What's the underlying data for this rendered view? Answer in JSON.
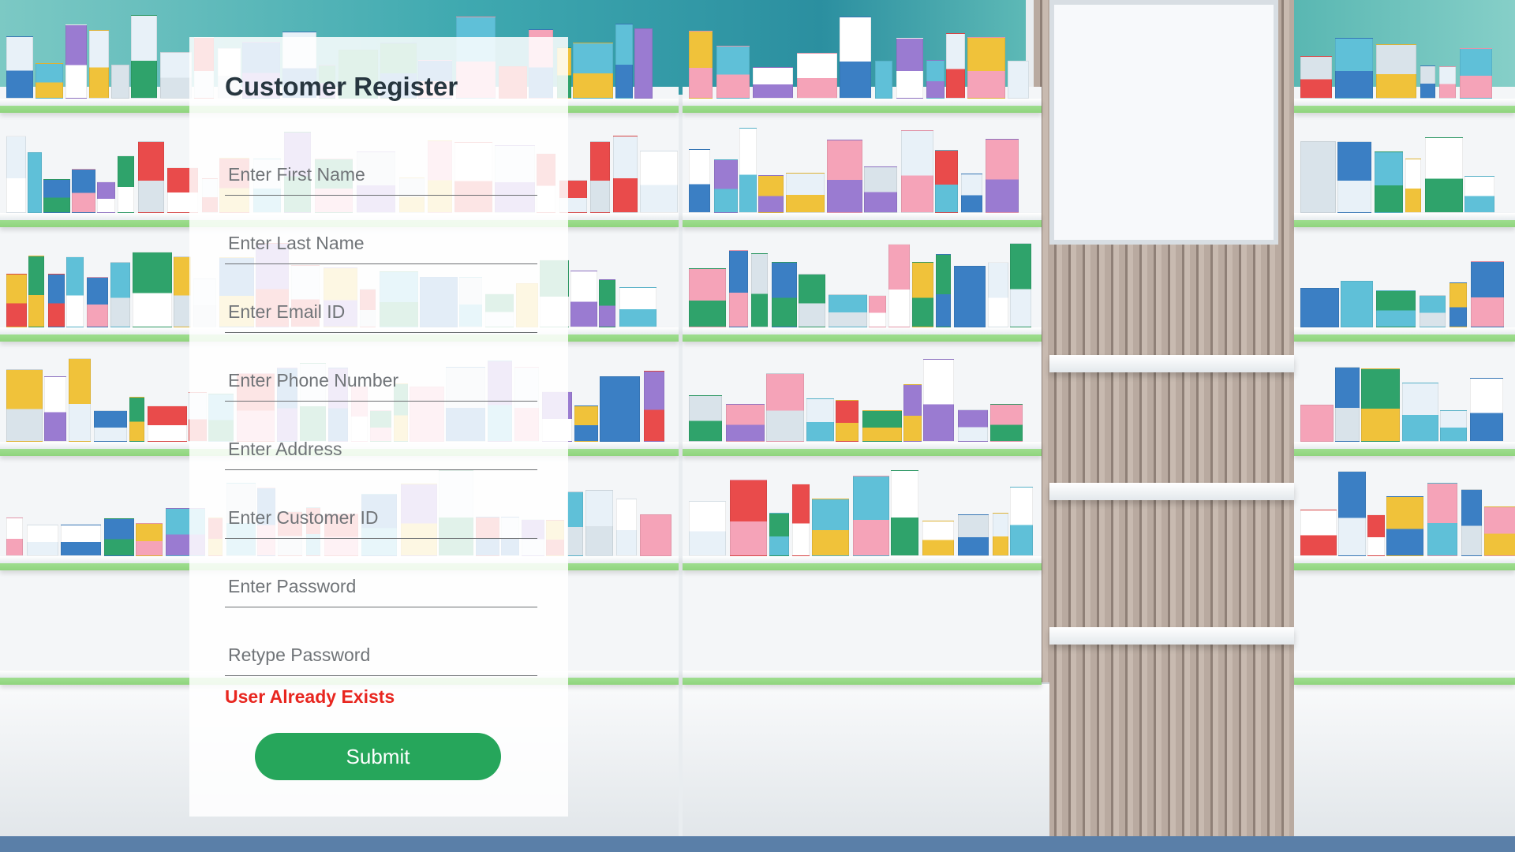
{
  "form": {
    "title": "Customer Register",
    "fields": [
      {
        "name": "first-name-input",
        "placeholder": "Enter First Name",
        "type": "text"
      },
      {
        "name": "last-name-input",
        "placeholder": "Enter Last Name",
        "type": "text"
      },
      {
        "name": "email-input",
        "placeholder": "Enter Email ID",
        "type": "email"
      },
      {
        "name": "phone-input",
        "placeholder": "Enter Phone Number",
        "type": "tel"
      },
      {
        "name": "address-input",
        "placeholder": "Enter Address",
        "type": "text"
      },
      {
        "name": "customer-id-input",
        "placeholder": "Enter Customer ID",
        "type": "text"
      },
      {
        "name": "password-input",
        "placeholder": "Enter Password",
        "type": "password"
      },
      {
        "name": "retype-password-input",
        "placeholder": "Retype Password",
        "type": "password"
      }
    ],
    "error_message": "User Already Exists",
    "submit_label": "Submit"
  },
  "colors": {
    "error": "#e8261f",
    "submit": "#26a65b",
    "title": "#27363f"
  },
  "background": {
    "scene": "pharmacy-shelves-image"
  }
}
